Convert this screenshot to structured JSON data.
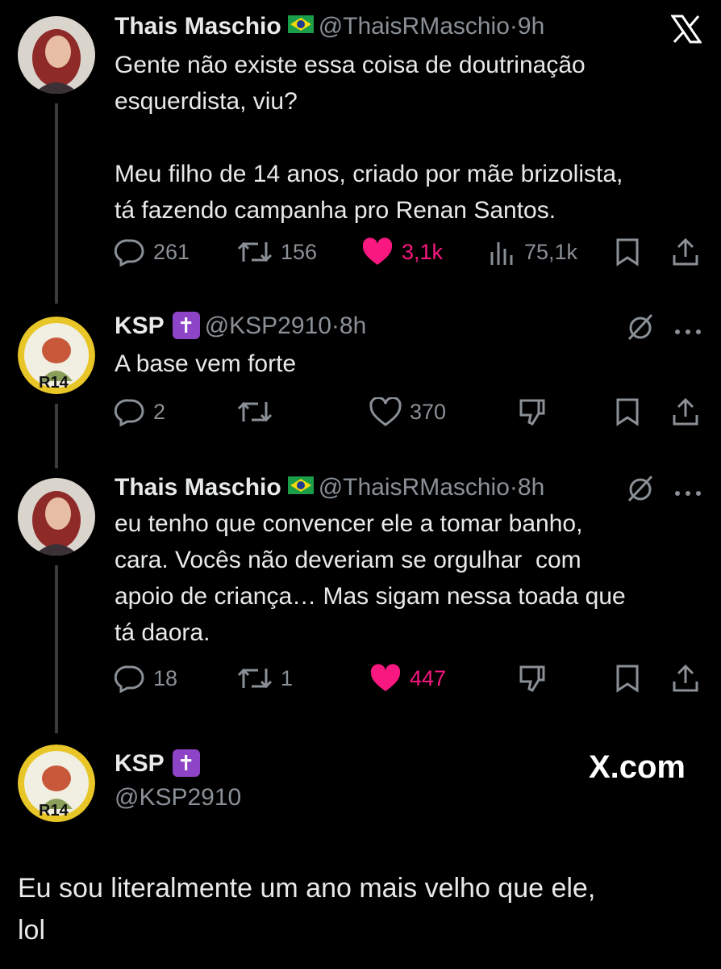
{
  "tweets": [
    {
      "name": "Thais Maschio",
      "handle": "@ThaisRMaschio",
      "time": "9h",
      "text": "Gente não existe essa coisa de doutrinação\nesquerdista, viu?\n\nMeu filho de 14 anos, criado por mãe brizolista,\ntá fazendo campanha pro Renan Santos.",
      "replies": "261",
      "reposts": "156",
      "likes": "3,1k",
      "views": "75,1k"
    },
    {
      "name": "KSP",
      "handle": "@KSP2910",
      "time": "8h",
      "text": "A base vem forte",
      "replies": "2",
      "reposts": "",
      "likes": "370"
    },
    {
      "name": "Thais Maschio",
      "handle": "@ThaisRMaschio",
      "time": "8h",
      "text": "eu tenho que convencer ele a tomar banho,\ncara. Vocês não deveriam se orgulhar  com\napoio de criança… Mas sigam nessa toada que\ntá daora.",
      "replies": "18",
      "reposts": "1",
      "likes": "447"
    }
  ],
  "final": {
    "name": "KSP",
    "handle": "@KSP2910",
    "site": "X.com",
    "text": "Eu sou literalmente um ano mais velho que ele,\nlol"
  },
  "badge_glyph": "✝",
  "separator": "·",
  "colors": {
    "like_active": "#f91880",
    "muted": "#8a9096",
    "badge": "#8e44c7"
  },
  "icons": [
    "x-logo-icon",
    "reply-icon",
    "repost-icon",
    "heart-icon",
    "views-icon",
    "bookmark-icon",
    "share-icon",
    "grok-icon",
    "more-icon",
    "dislike-icon"
  ]
}
